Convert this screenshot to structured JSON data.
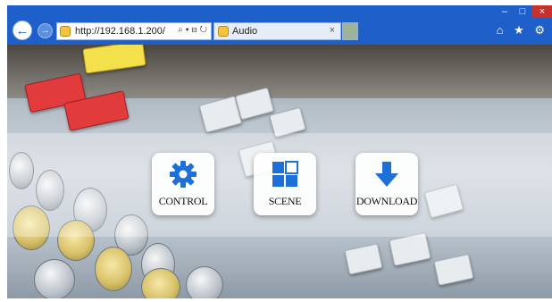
{
  "browser": {
    "window_controls": {
      "minimize": "–",
      "maximize": "□",
      "close": "×"
    },
    "back_icon": "←",
    "forward_icon": "→",
    "address": {
      "url": "http://192.168.1.200/",
      "tools": "⌕ ▾ ⊟ ↻"
    },
    "tab": {
      "title": "Audio",
      "close": "×"
    },
    "right_tools": "⌂ ★ ⚙"
  },
  "menu": {
    "items": [
      {
        "label": "CONTROL",
        "icon": "gear-icon"
      },
      {
        "label": "SCENE",
        "icon": "scene-grid-icon"
      },
      {
        "label": "DOWNLOAD",
        "icon": "download-arrow-icon"
      }
    ]
  },
  "colors": {
    "browser_chrome": "#1f5fc9",
    "icon_blue": "#1f6fd8"
  }
}
